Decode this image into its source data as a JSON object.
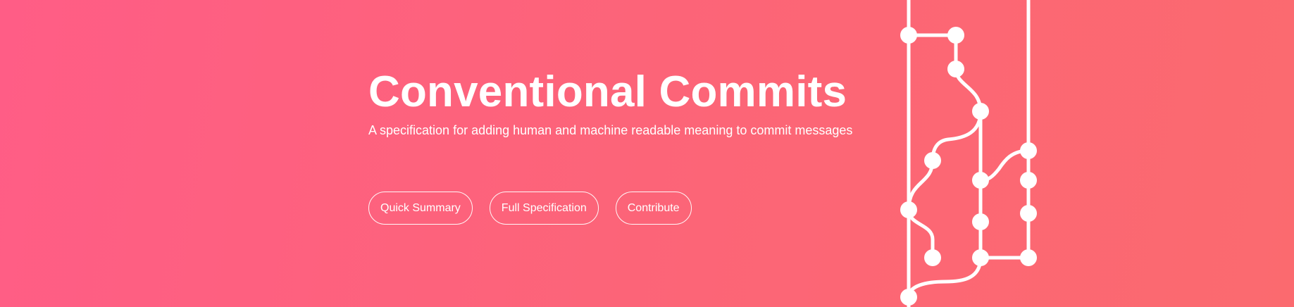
{
  "hero": {
    "title": "Conventional Commits",
    "subtitle": "A specification for adding human and machine readable meaning to commit messages",
    "buttons": [
      {
        "label": "Quick Summary"
      },
      {
        "label": "Full Specification"
      },
      {
        "label": "Contribute"
      }
    ],
    "graph_icon": "commit-graph-icon"
  },
  "colors": {
    "gradient_start": "#ff5d86",
    "gradient_end": "#fb6a6f",
    "text": "#ffffff",
    "graph": "#ffffff"
  }
}
